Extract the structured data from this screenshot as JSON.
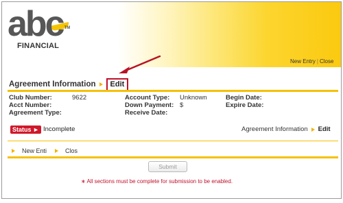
{
  "header": {
    "logo": {
      "word": "abc",
      "tm": "TM",
      "subtitle": "FINANCIAL"
    },
    "links": {
      "new_entry": "New Entry",
      "separator": "|",
      "close": "Close"
    }
  },
  "agreement": {
    "title": "Agreement Information",
    "edit_label": "Edit",
    "fields": {
      "club_number_label": "Club Number:",
      "club_number_value": "9622",
      "acct_number_label": "Acct Number:",
      "agreement_type_label": "Agreement Type:",
      "account_type_label": "Account Type:",
      "account_type_value": "Unknown",
      "down_payment_label": "Down Payment:",
      "down_payment_value": "$",
      "receive_date_label": "Receive Date:",
      "begin_date_label": "Begin Date:",
      "expire_date_label": "Expire Date:"
    }
  },
  "status": {
    "badge_label": "Status ►",
    "value": "Incomplete",
    "section_link": "Agreement Information",
    "edit_label": "Edit"
  },
  "sub_links": {
    "new_entry": "New Enti",
    "close": "Clos"
  },
  "submit": {
    "label": "Submit"
  },
  "notice": "∗ All sections must be complete for submission to be enabled.",
  "colors": {
    "accent_yellow": "#f5c000",
    "alert_red": "#c0102a",
    "logo_gray": "#575757"
  }
}
